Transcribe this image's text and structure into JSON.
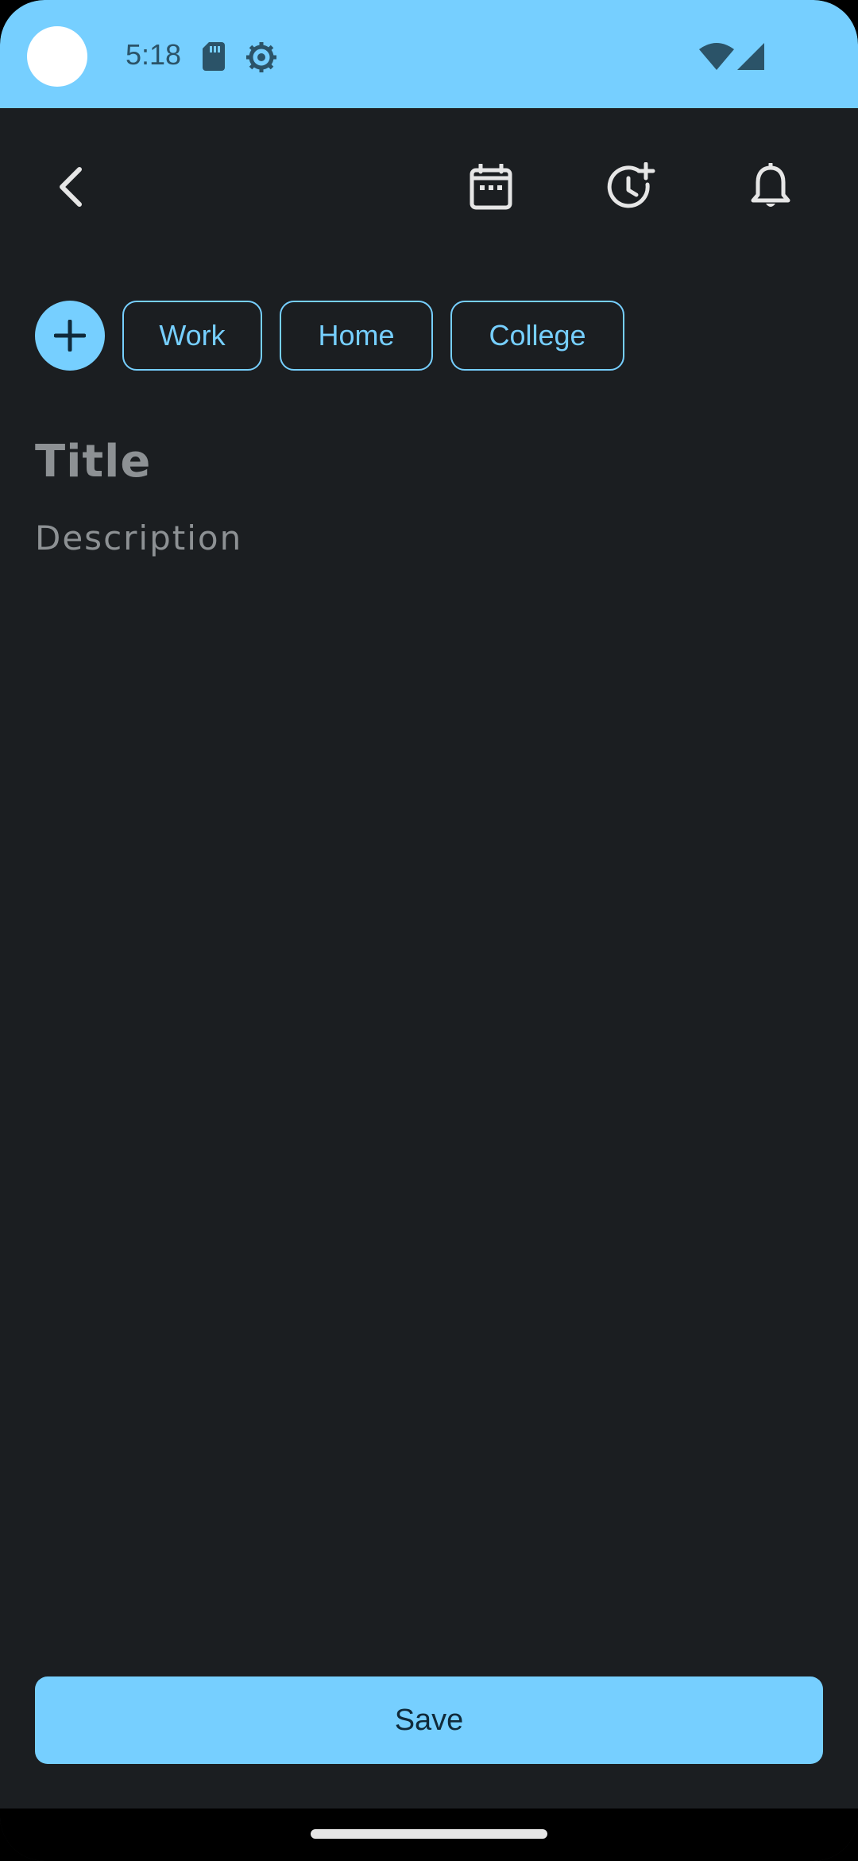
{
  "status_bar": {
    "time": "5:18",
    "icons": [
      "sd-card-icon",
      "gear-icon",
      "wifi-icon",
      "signal-icon"
    ],
    "background": "#76cfff"
  },
  "toolbar": {
    "icons": [
      "back-arrow-icon",
      "calendar-icon",
      "alarm-add-icon",
      "bell-icon"
    ]
  },
  "tags": {
    "add_icon": "plus-icon",
    "items": [
      {
        "label": "Work"
      },
      {
        "label": "Home"
      },
      {
        "label": "College"
      }
    ]
  },
  "form": {
    "title_placeholder": "Title",
    "description_placeholder": "Description"
  },
  "actions": {
    "save_label": "Save"
  },
  "colors": {
    "accent": "#76cfff",
    "background": "#1b1e21",
    "placeholder": "#8d9194",
    "icon": "#e6e6e6"
  }
}
